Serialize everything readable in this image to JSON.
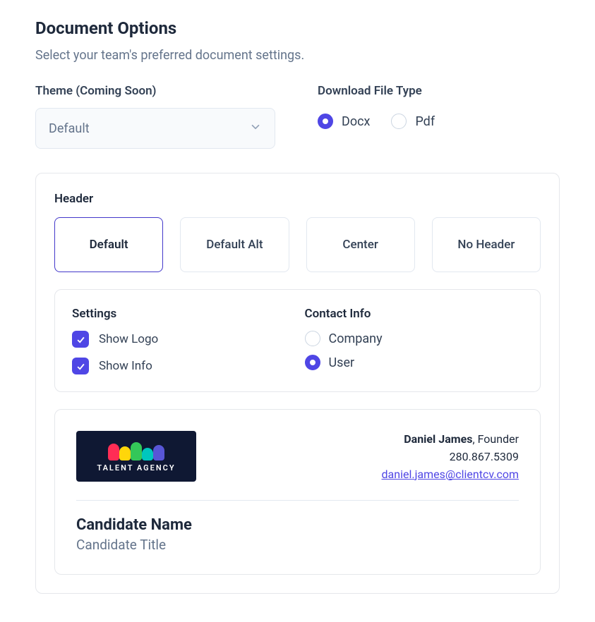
{
  "page": {
    "title": "Document Options",
    "subtitle": "Select your team's preferred document settings."
  },
  "theme": {
    "label": "Theme (Coming Soon)",
    "selected": "Default"
  },
  "download": {
    "label": "Download File Type",
    "options": {
      "docx": "Docx",
      "pdf": "Pdf"
    },
    "selected": "docx"
  },
  "header": {
    "title": "Header",
    "tabs": [
      {
        "key": "default",
        "label": "Default",
        "active": true
      },
      {
        "key": "default_alt",
        "label": "Default Alt",
        "active": false
      },
      {
        "key": "center",
        "label": "Center",
        "active": false
      },
      {
        "key": "no_header",
        "label": "No Header",
        "active": false
      }
    ]
  },
  "settings": {
    "title": "Settings",
    "show_logo": {
      "label": "Show Logo",
      "checked": true
    },
    "show_info": {
      "label": "Show Info",
      "checked": true
    }
  },
  "contact_info": {
    "title": "Contact Info",
    "options": {
      "company": "Company",
      "user": "User"
    },
    "selected": "user"
  },
  "preview": {
    "logo_text": "TALENT AGENCY",
    "contact": {
      "name": "Daniel James",
      "role_separator": ", ",
      "role": "Founder",
      "phone": "280.867.5309",
      "email": "daniel.james@clientcv.com"
    },
    "candidate": {
      "name": "Candidate Name",
      "title": "Candidate Title"
    }
  },
  "colors": {
    "accent": "#4f46e5",
    "logo_bg": "#0f1833"
  }
}
